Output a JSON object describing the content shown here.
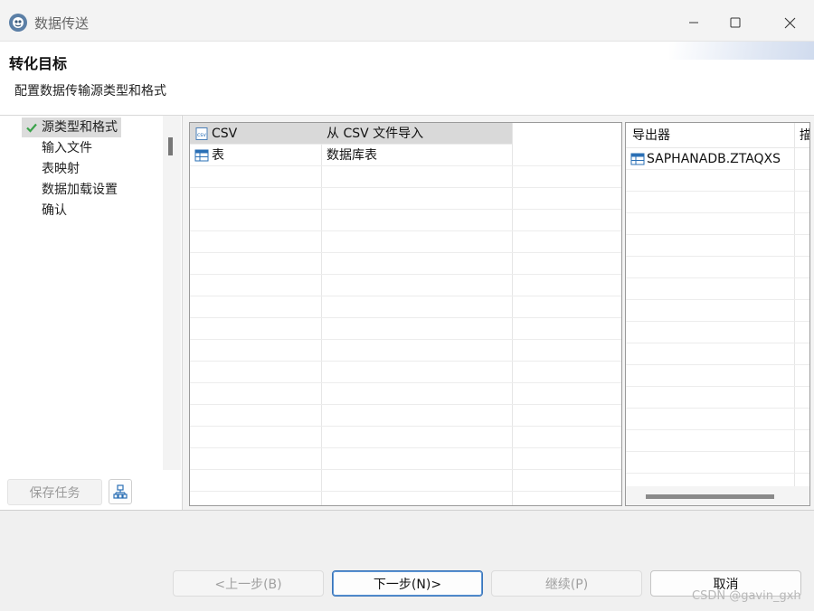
{
  "window": {
    "title": "数据传送"
  },
  "header": {
    "title": "转化目标",
    "description": "配置数据传输源类型和格式"
  },
  "steps": [
    {
      "label": "源类型和格式",
      "active": true
    },
    {
      "label": "输入文件",
      "active": false
    },
    {
      "label": "表映射",
      "active": false
    },
    {
      "label": "数据加载设置",
      "active": false
    },
    {
      "label": "确认",
      "active": false
    }
  ],
  "left_buttons": {
    "save_task": "保存任务"
  },
  "source_table": {
    "rows": [
      {
        "type": "CSV",
        "description": "从 CSV 文件导入",
        "icon": "csv-icon",
        "selected": true
      },
      {
        "type": "表",
        "description": "数据库表",
        "icon": "table-icon",
        "selected": false
      }
    ]
  },
  "target_table": {
    "columns": [
      "导出器",
      "描"
    ],
    "rows": [
      {
        "name": "SAPHANADB.ZTAQXS",
        "icon": "table-icon"
      }
    ]
  },
  "footer": {
    "prev": "<上一步(B)",
    "next": "下一步(N)>",
    "continue": "继续(P)",
    "cancel": "取消"
  },
  "watermark": "CSDN @gavin_gxh",
  "colors": {
    "accent": "#3a74b8",
    "selected_row": "#d9d9d9",
    "check_green": "#3aa24a"
  }
}
